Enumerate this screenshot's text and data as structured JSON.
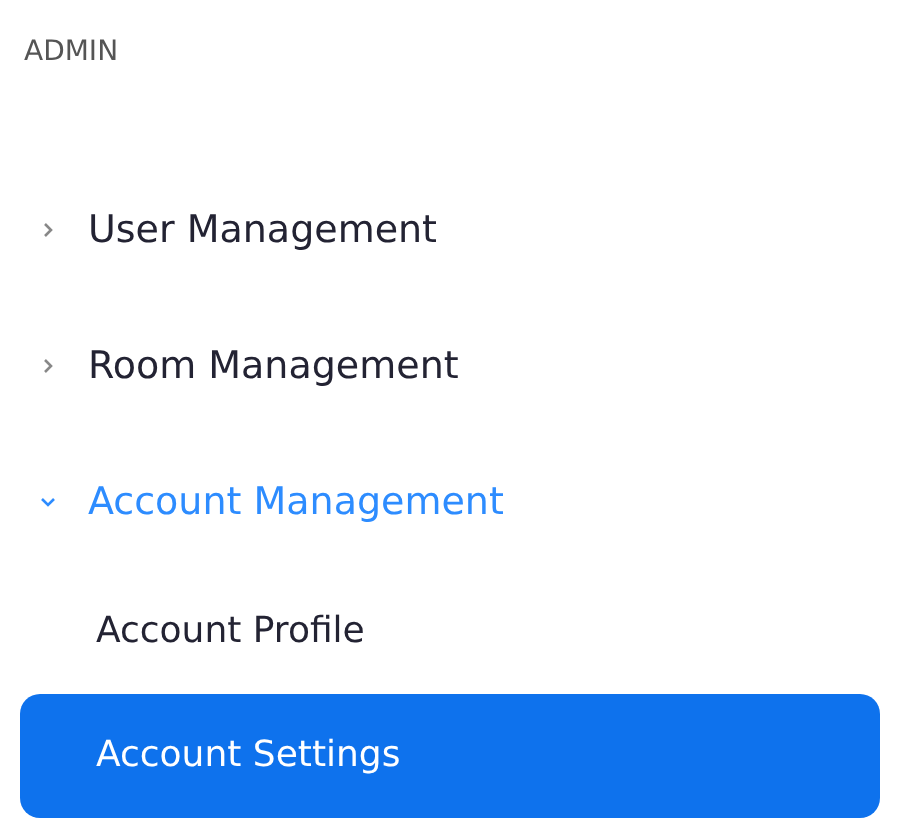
{
  "section": {
    "title": "ADMIN"
  },
  "items": [
    {
      "label": "User Management",
      "expanded": false
    },
    {
      "label": "Room Management",
      "expanded": false
    },
    {
      "label": "Account Management",
      "expanded": true,
      "children": [
        {
          "label": "Account Profile",
          "selected": false
        },
        {
          "label": "Account Settings",
          "selected": true
        }
      ]
    }
  ]
}
